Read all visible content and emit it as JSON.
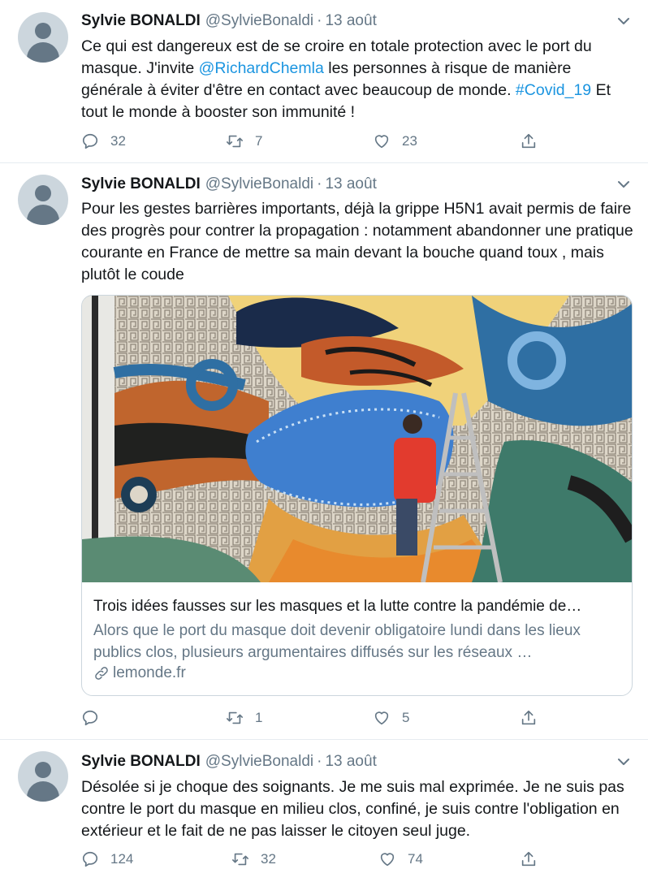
{
  "tweets": [
    {
      "name": "Sylvie BONALDI",
      "handle": "@SylvieBonaldi",
      "date": "13 août",
      "text_parts": [
        "Ce qui est dangereux est de se croire en totale protection avec le port du masque. J'invite ",
        "@RichardChemla",
        " les personnes à risque de manière générale à éviter d'être en contact avec beaucoup de monde. ",
        "#Covid_19",
        " Et tout le monde à booster son immunité !"
      ],
      "replies": "32",
      "retweets": "7",
      "likes": "23"
    },
    {
      "name": "Sylvie BONALDI",
      "handle": "@SylvieBonaldi",
      "date": "13 août",
      "text": "Pour les gestes barrières  importants, déjà la grippe H5N1 avait permis de faire des progrès pour contrer la propagation : notamment abandonner une pratique courante en France de mettre sa main devant la bouche quand toux , mais plutôt le coude",
      "card": {
        "title": "Trois idées fausses sur les masques et la lutte contre la pandémie de…",
        "description": "Alors que le port du masque doit devenir obligatoire lundi dans les lieux publics clos, plusieurs argumentaires diffusés sur les réseaux …",
        "domain": "lemonde.fr"
      },
      "replies": "",
      "retweets": "1",
      "likes": "5"
    },
    {
      "name": "Sylvie BONALDI",
      "handle": "@SylvieBonaldi",
      "date": "13 août",
      "text": "Désolée si je choque des soignants. Je me suis mal exprimée.  Je ne suis pas contre le port du masque en milieu clos, confiné,  je suis contre l'obligation en extérieur et le fait de ne pas laisser le citoyen seul juge.",
      "replies": "124",
      "retweets": "32",
      "likes": "74"
    }
  ],
  "colors": {
    "accent": "#1b95e0",
    "muted": "#657786",
    "divider": "#e6ecf0"
  }
}
